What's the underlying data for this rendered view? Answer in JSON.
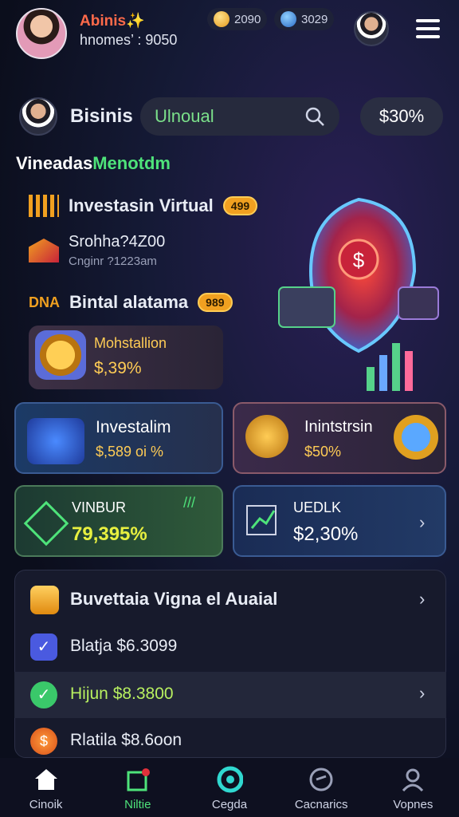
{
  "header": {
    "username": "Abinis✨",
    "balance": "hnomes’ : 9050",
    "coins": "2090",
    "gems": "3029"
  },
  "profile_row": {
    "name": "Bisinis",
    "search_text": "Ulnoual",
    "percent": "$30%"
  },
  "section": {
    "title_white": "Vineadas",
    "title_green": "Menotdm"
  },
  "list": [
    {
      "label": "Investasin Virtual",
      "badge": "499"
    },
    {
      "label": "Srohha?4Z00",
      "sub": "Cnginr ?1223am"
    },
    {
      "label": "Bintal alatama",
      "badge": "989"
    }
  ],
  "gold_card": {
    "title": "Mohstallion",
    "value": "$,39%"
  },
  "cards": [
    {
      "title": "Investalim",
      "value": "$,589 oi %"
    },
    {
      "title": "Inintstrsin",
      "value": "$50%"
    },
    {
      "title": "VINBUR",
      "value": "79,395%"
    },
    {
      "title": "UEDLK",
      "value": "$2,30%"
    }
  ],
  "panel": {
    "header": "Buvettaia Vigna el Auaial",
    "rows": [
      {
        "label": "Blatja $6.3099"
      },
      {
        "label": "Hijun $8.3800"
      },
      {
        "label": "Rlatila $8.6oon"
      }
    ]
  },
  "nav": [
    {
      "label": "Cinoik"
    },
    {
      "label": "Niltie"
    },
    {
      "label": "Cegda"
    },
    {
      "label": "Cacnarics"
    },
    {
      "label": "Vopnes"
    }
  ],
  "colors": {
    "accent_green": "#4ee37a",
    "accent_orange": "#f0a020",
    "bg": "#0d1020"
  }
}
